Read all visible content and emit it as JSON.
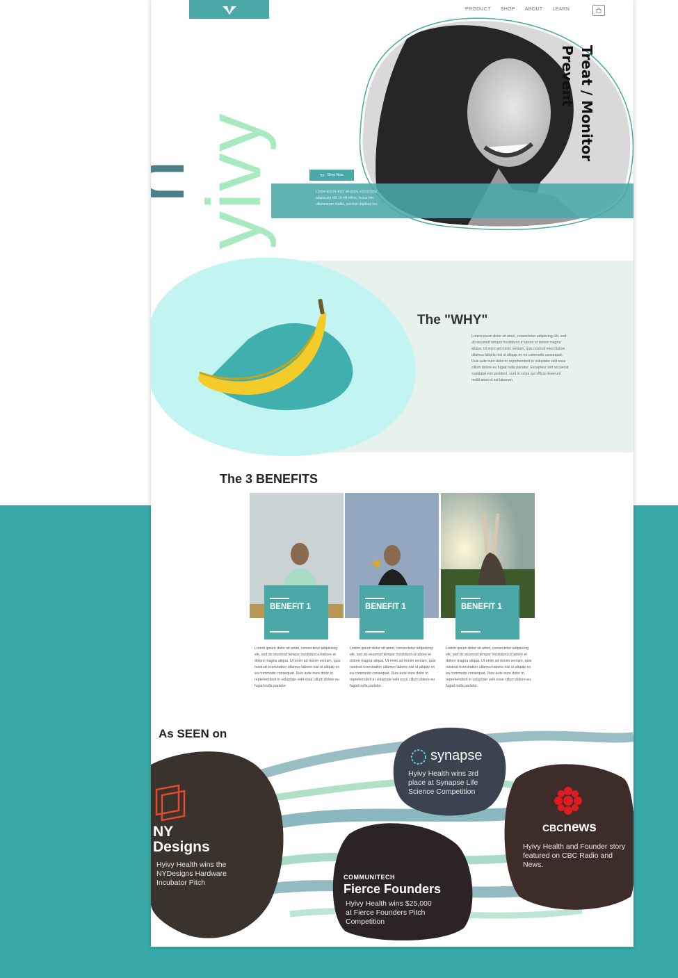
{
  "nav": {
    "links": [
      "PRODUCT",
      "SHOP",
      "ABOUT",
      "LEARN"
    ]
  },
  "hero": {
    "brand": "hyivy",
    "tagline": "Treat / Monitor\nPrevent",
    "cta_label": "Shop Now",
    "blurb": "Lorem ipsum dolor sit amet, consectetur adipiscing elit. Ut elit tellus, luctus nec ullamcorper mattis, pulvinar dapibus leo."
  },
  "why": {
    "title": "The \"WHY\"",
    "body": "Lorem ipsum dolor sit amet, consectetur adipiscing elit, sed do eiusmod tempor incididunt ut labore et dolore magna aliqua. Ut enim ad minim veniam, quis nostrud exercitation ullamco laboris nisi ut aliquip ex ea commodo consequat. Duis aute irure dolor in reprehenderit in voluptate velit esse cillum dolore eu fugiat nulla pariatur. Excepteur sint occaecat cupidatat non proident, sunt in culpa qui officia deserunt mollit anim id est laborum."
  },
  "benefits": {
    "title": "The 3 BENEFITS",
    "items": [
      {
        "label": "BENEFIT 1",
        "text": "Lorem ipsum dolor sit amet, consectetur adipiscing elit, sed do eiusmod tempor incididunt ut labore et dolore magna aliqua. Ut enim ad minim veniam, quis nostrud exercitation ullamco laboris nisi ut aliquip ex ea commodo consequat. Duis aute irure dolor in reprehenderit in voluptate velit esse cillum dolore eu fugiat nulla pariatur."
      },
      {
        "label": "BENEFIT 1",
        "text": "Lorem ipsum dolor sit amet, consectetur adipiscing elit, sed do eiusmod tempor incididunt ut labore et dolore magna aliqua. Ut enim ad minim veniam, quis nostrud exercitation ullamco laboris nisi ut aliquip ex ea commodo consequat. Duis aute irure dolor in reprehenderit in voluptate velit esse cillum dolore eu fugiat nulla pariatur."
      },
      {
        "label": "BENEFIT 1",
        "text": "Lorem ipsum dolor sit amet, consectetur adipiscing elit, sed do eiusmod tempor incididunt ut labore et dolore magna aliqua. Ut enim ad minim veniam, quis nostrud exercitation ullamco laboris nisi ut aliquip ex ea commodo consequat. Duis aute irure dolor in reprehenderit in voluptate velit esse cillum dolore eu fugiat nulla pariatur."
      }
    ]
  },
  "press": {
    "title": "As SEEN on",
    "nydesigns": {
      "name": "NY\nDesigns",
      "text": "Hyivy Health wins the NYDesigns Hardware Incubator Pitch"
    },
    "synapse": {
      "name": "synapse",
      "text": "Hyivy Health wins 3rd place at Synapse Life Science Competition"
    },
    "communitech": {
      "kicker": "COMMUNITECH",
      "name": "Fierce Founders",
      "text": "Hyivy Health wins $25,000 at Fierce Founders Pitch Competition"
    },
    "cbc": {
      "prefix": "CBC",
      "name": "news",
      "text": "Hyivy Health and Founder story featured on CBC Radio and News."
    }
  },
  "colors": {
    "teal": "#4aa9a7",
    "page_bg_band": "#3aa9aa",
    "mint": "#c2f5f2",
    "sage": "#e8f2ec"
  }
}
